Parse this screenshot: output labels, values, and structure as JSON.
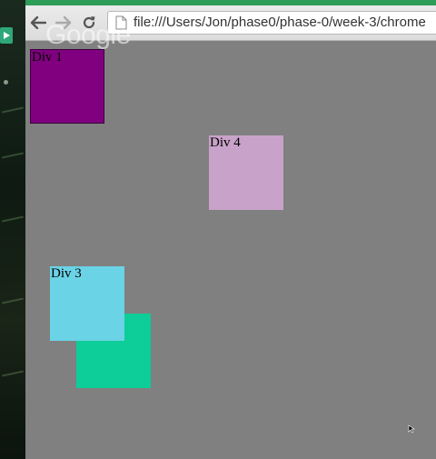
{
  "browser": {
    "url": "file:///Users/Jon/phase0/phase-0/week-3/chrome",
    "watermark": "Google",
    "accent_color": "#2d9d57"
  },
  "page": {
    "background": "#808080",
    "boxes": [
      {
        "label": "Div 1",
        "color": "#800080"
      },
      {
        "label": "Div 4",
        "color": "#c8a2c8"
      },
      {
        "label": "Div 3",
        "color": "#6bd3e6"
      },
      {
        "label": "",
        "color": "#0dcd98"
      }
    ]
  },
  "icons": [
    "back-arrow-icon",
    "forward-arrow-icon",
    "reload-icon",
    "page-icon",
    "mouse-cursor-icon"
  ]
}
